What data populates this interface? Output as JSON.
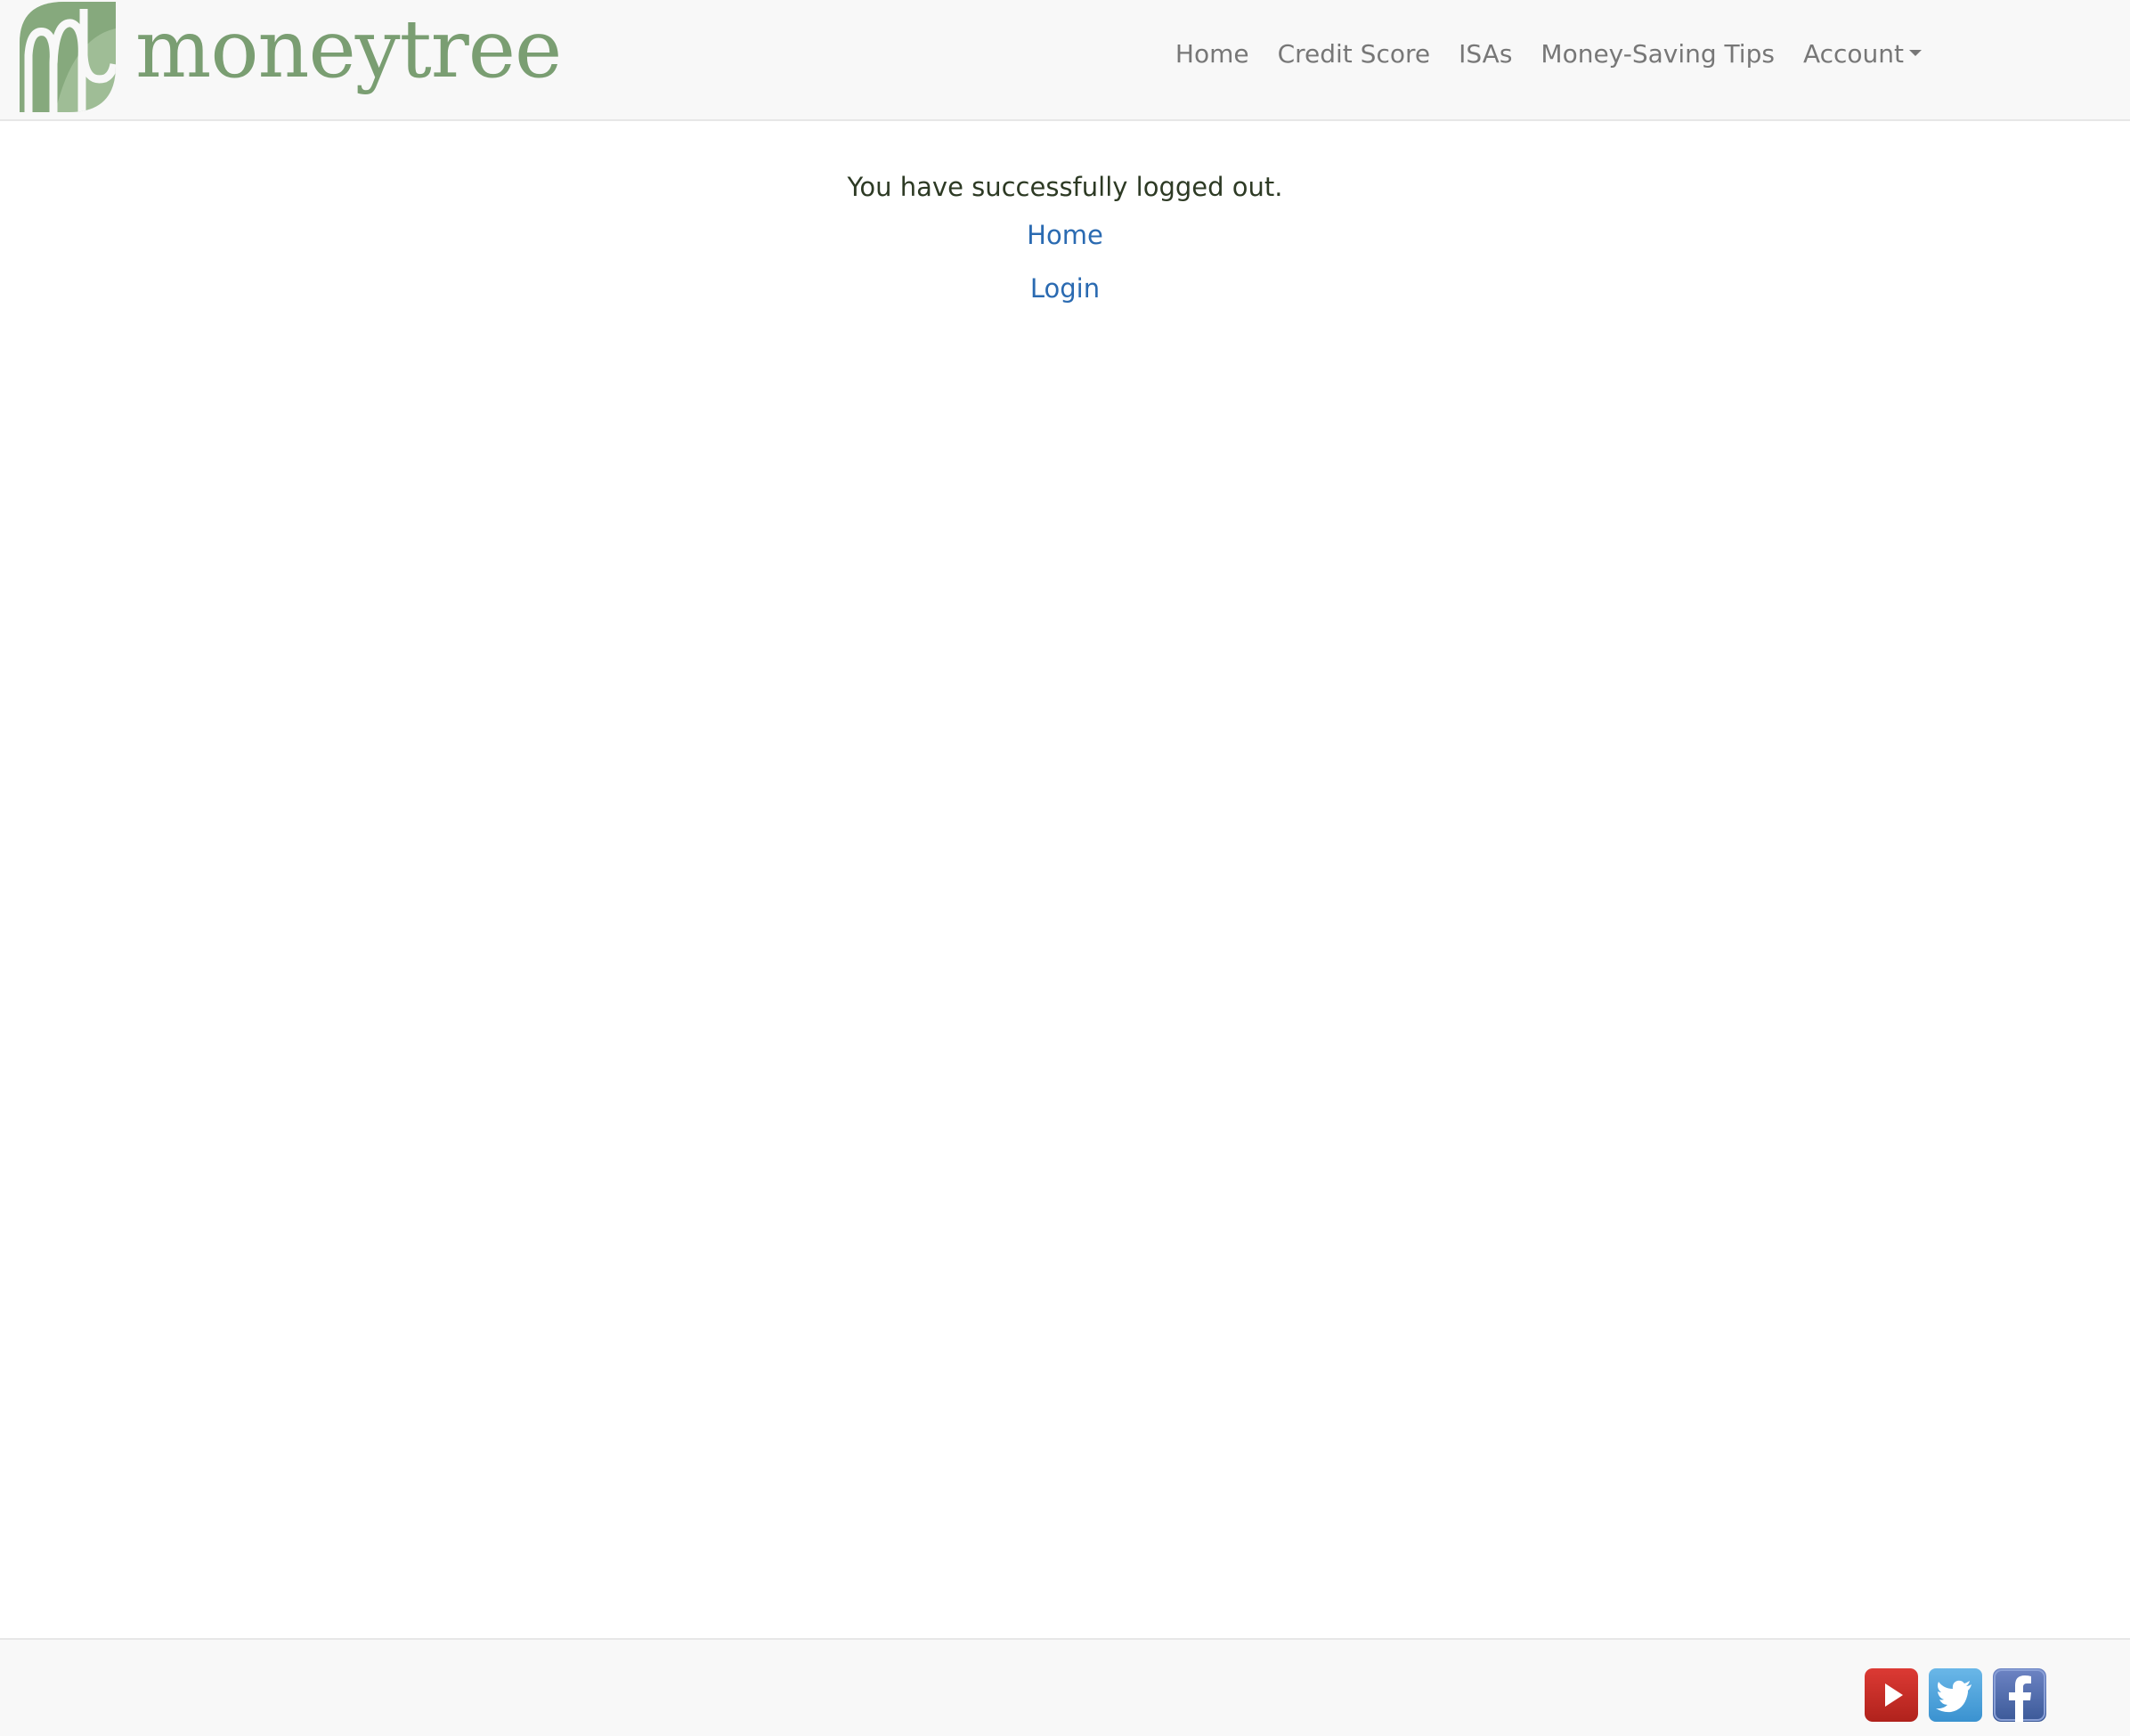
{
  "header": {
    "brand_name": "moneytree",
    "brand_color": "#7a9e72",
    "nav": [
      {
        "label": "Home"
      },
      {
        "label": "Credit Score"
      },
      {
        "label": "ISAs"
      },
      {
        "label": "Money-Saving Tips"
      },
      {
        "label": "Account",
        "has_dropdown": true
      }
    ]
  },
  "main": {
    "message": "You have successfully logged out.",
    "links": [
      {
        "label": "Home"
      },
      {
        "label": "Login"
      }
    ],
    "link_color": "#2a6ab1"
  },
  "footer": {
    "social_icons": [
      {
        "icon": "youtube-icon",
        "color": "#c4302b"
      },
      {
        "icon": "twitter-icon",
        "color": "#4aa3df"
      },
      {
        "icon": "facebook-icon",
        "color": "#3b5998"
      }
    ]
  }
}
